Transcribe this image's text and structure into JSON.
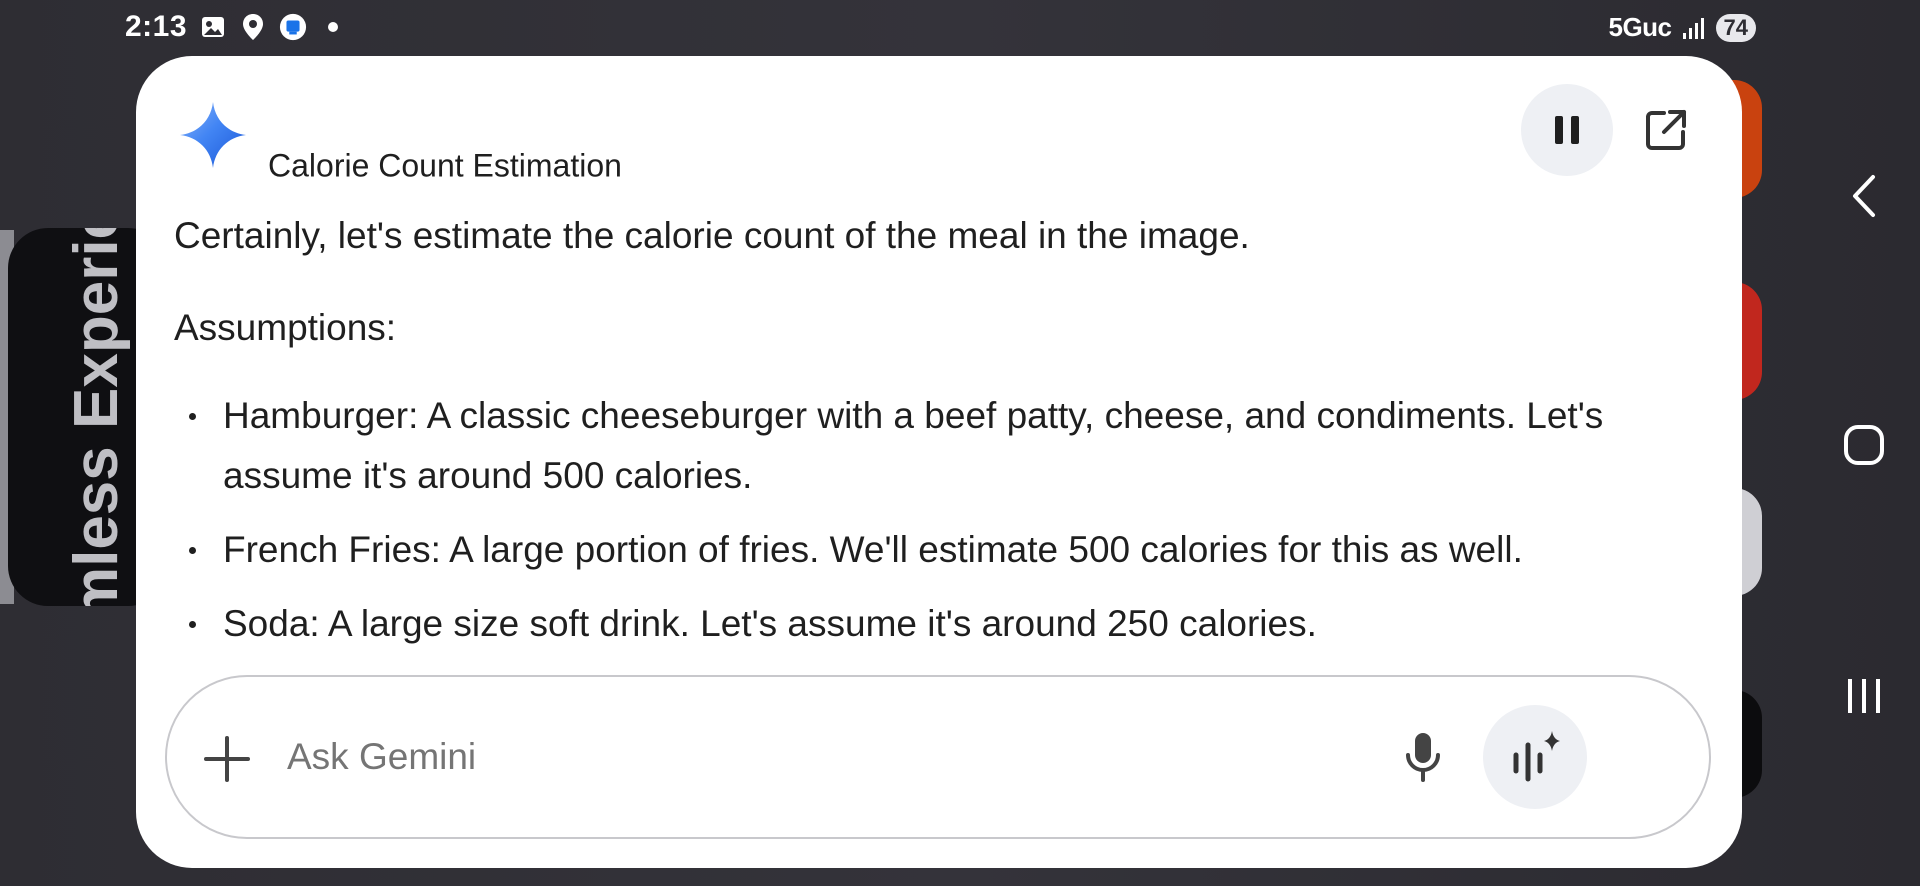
{
  "status_bar": {
    "time": "2:13",
    "network": "5Guc",
    "battery": "74",
    "icons": [
      "gallery-icon",
      "location-icon",
      "app-notification-icon",
      "dot-icon",
      "signal-icon"
    ]
  },
  "background": {
    "left_card_text": "mless Experie"
  },
  "gemini_panel": {
    "title": "Calorie Count Estimation",
    "logo": "gemini-sparkle-icon",
    "pause_icon": "pause-icon",
    "open_icon": "open-in-new-icon",
    "intro": "Certainly, let's estimate the calorie count of the meal in the image.",
    "assumptions_label": "Assumptions:",
    "bullets": [
      "Hamburger:  A classic cheeseburger with a beef patty, cheese, and condiments. Let's assume it's around 500 calories.",
      "French Fries: A large portion of fries. We'll estimate 500 calories for this as well.",
      "Soda: A large size soft drink. Let's assume it's around 250 calories."
    ],
    "input": {
      "placeholder": "Ask Gemini",
      "value": ""
    }
  },
  "colors": {
    "accent_blue": "#4285f4",
    "card_bg": "#ffffff",
    "button_bg": "#eef0f4",
    "text": "#1f1f1f",
    "placeholder": "#757575"
  },
  "nav": {
    "back_icon": "chevron-left-icon",
    "home_icon": "home-icon",
    "recents_icon": "recents-icon"
  }
}
